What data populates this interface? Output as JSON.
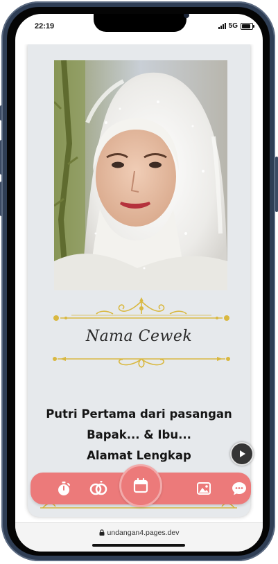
{
  "status_bar": {
    "time": "22:19",
    "network": "5G"
  },
  "invitation": {
    "bride_name": "Nama Cewek",
    "description_lines": [
      "Putri Pertama dari pasangan",
      "Bapak... & Ibu...",
      "Alamat Lengkap"
    ]
  },
  "bottom_nav": {
    "items": [
      "timer-icon",
      "couple-icon",
      "calendar-icon",
      "gallery-icon",
      "chat-icon"
    ],
    "active": "calendar-icon"
  },
  "browser": {
    "url": "undangan4.pages.dev"
  },
  "colors": {
    "accent": "#ec7a7a",
    "gold": "#d9b840",
    "card_bg": "#e6e9ec",
    "phone_frame": "#2f3e55"
  }
}
